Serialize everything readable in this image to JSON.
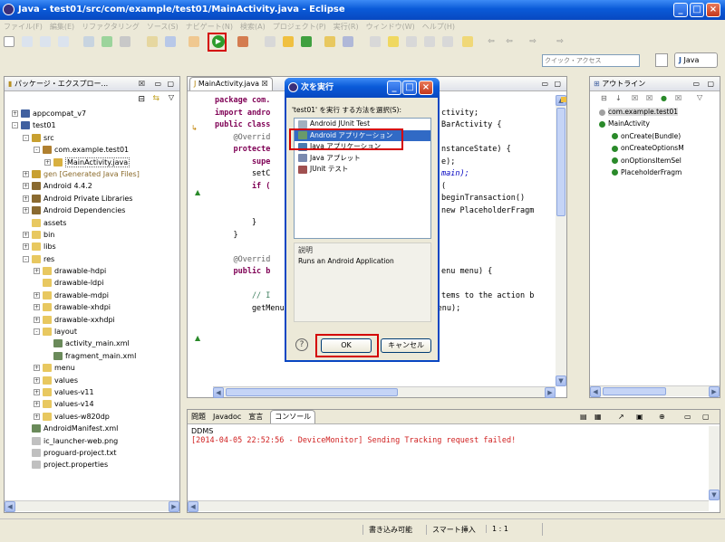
{
  "window": {
    "title": "Java - test01/src/com/example/test01/MainActivity.java - Eclipse"
  },
  "menu": [
    "ファイル(F)",
    "編集(E)",
    "リファクタリング",
    "ソース(S)",
    "ナビゲート(N)",
    "検索(A)",
    "プロジェクト(P)",
    "実行(R)",
    "ウィンドウ(W)",
    "ヘルプ(H)"
  ],
  "quick_access": {
    "placeholder": "クイック・アクセス"
  },
  "perspective": {
    "label": "Java"
  },
  "package_explorer": {
    "title": "パッケージ・エクスプロー...",
    "items": [
      {
        "label": "appcompat_v7",
        "indent": 0,
        "exp": "+",
        "icon": "project"
      },
      {
        "label": "test01",
        "indent": 0,
        "exp": "-",
        "icon": "project"
      },
      {
        "label": "src",
        "indent": 1,
        "exp": "-",
        "icon": "srcfolder"
      },
      {
        "label": "com.example.test01",
        "indent": 2,
        "exp": "-",
        "icon": "package"
      },
      {
        "label": "MainActivity.java",
        "indent": 3,
        "exp": "+",
        "icon": "java",
        "selected": true
      },
      {
        "label": "gen [Generated Java Files]",
        "indent": 1,
        "exp": "+",
        "icon": "srcfolder",
        "gray": true
      },
      {
        "label": "Android 4.4.2",
        "indent": 1,
        "exp": "+",
        "icon": "lib"
      },
      {
        "label": "Android Private Libraries",
        "indent": 1,
        "exp": "+",
        "icon": "lib"
      },
      {
        "label": "Android Dependencies",
        "indent": 1,
        "exp": "+",
        "icon": "lib"
      },
      {
        "label": "assets",
        "indent": 1,
        "exp": "",
        "icon": "folder"
      },
      {
        "label": "bin",
        "indent": 1,
        "exp": "+",
        "icon": "folder"
      },
      {
        "label": "libs",
        "indent": 1,
        "exp": "+",
        "icon": "folder"
      },
      {
        "label": "res",
        "indent": 1,
        "exp": "-",
        "icon": "folder"
      },
      {
        "label": "drawable-hdpi",
        "indent": 2,
        "exp": "+",
        "icon": "folder"
      },
      {
        "label": "drawable-ldpi",
        "indent": 2,
        "exp": "",
        "icon": "folder"
      },
      {
        "label": "drawable-mdpi",
        "indent": 2,
        "exp": "+",
        "icon": "folder"
      },
      {
        "label": "drawable-xhdpi",
        "indent": 2,
        "exp": "+",
        "icon": "folder"
      },
      {
        "label": "drawable-xxhdpi",
        "indent": 2,
        "exp": "+",
        "icon": "folder"
      },
      {
        "label": "layout",
        "indent": 2,
        "exp": "-",
        "icon": "folder"
      },
      {
        "label": "activity_main.xml",
        "indent": 3,
        "exp": "",
        "icon": "xml"
      },
      {
        "label": "fragment_main.xml",
        "indent": 3,
        "exp": "",
        "icon": "xml"
      },
      {
        "label": "menu",
        "indent": 2,
        "exp": "+",
        "icon": "folder"
      },
      {
        "label": "values",
        "indent": 2,
        "exp": "+",
        "icon": "folder"
      },
      {
        "label": "values-v11",
        "indent": 2,
        "exp": "+",
        "icon": "folder"
      },
      {
        "label": "values-v14",
        "indent": 2,
        "exp": "+",
        "icon": "folder"
      },
      {
        "label": "values-w820dp",
        "indent": 2,
        "exp": "+",
        "icon": "folder"
      },
      {
        "label": "AndroidManifest.xml",
        "indent": 1,
        "exp": "",
        "icon": "xml"
      },
      {
        "label": "ic_launcher-web.png",
        "indent": 1,
        "exp": "",
        "icon": "file"
      },
      {
        "label": "proguard-project.txt",
        "indent": 1,
        "exp": "",
        "icon": "file"
      },
      {
        "label": "project.properties",
        "indent": 1,
        "exp": "",
        "icon": "file"
      }
    ]
  },
  "editor": {
    "tab": "MainActivity.java",
    "lines": [
      {
        "t": "package com.",
        "k": true
      },
      {
        "t": "import andro",
        "k": true,
        "right": "ctivity;"
      },
      {
        "t": "public class",
        "k": true,
        "right": "BarActivity {"
      },
      {
        "t": "    @Overrid",
        "right": ""
      },
      {
        "t": "    protecte",
        "k": true,
        "right": "nstanceState) {"
      },
      {
        "t": "        supe",
        "k": true,
        "right": "e);"
      },
      {
        "t": "        setC",
        "right": "main);"
      },
      {
        "t": "        if (",
        "k": true,
        "right": "("
      },
      {
        "t": "",
        "right": "beginTransaction()"
      },
      {
        "t": "",
        "right": "new PlaceholderFragm"
      },
      {
        "t": "        }",
        "right": ""
      },
      {
        "t": "    }",
        "right": ""
      },
      {
        "t": "",
        "right": ""
      },
      {
        "t": "    @Overrid",
        "right": ""
      },
      {
        "t": "    public b",
        "k": true,
        "right": "enu menu) {"
      },
      {
        "t": "",
        "right": ""
      },
      {
        "t": "        // I",
        "right": "tems to the action b"
      },
      {
        "t": "        getMenuInflater().inflate(R.menu.main, menu);",
        "right": ""
      }
    ]
  },
  "outline": {
    "title": "アウトライン",
    "items": [
      {
        "label": "com.example.test01",
        "indent": 0
      },
      {
        "label": "MainActivity",
        "indent": 0
      },
      {
        "label": "onCreate(Bundle)",
        "indent": 1
      },
      {
        "label": "onCreateOptionsM",
        "indent": 1
      },
      {
        "label": "onOptionsItemSel",
        "indent": 1
      },
      {
        "label": "PlaceholderFragm",
        "indent": 1
      }
    ]
  },
  "console": {
    "tabs": [
      "問題",
      "Javadoc",
      "宣言",
      "コンソール"
    ],
    "header": "DDMS",
    "output": "[2014-04-05 22:52:56 - DeviceMonitor] Sending Tracking request failed!"
  },
  "dialog": {
    "title": "次を実行",
    "prompt": "'test01' を実行 する方法を選択(S):",
    "options": [
      "Android JUnit Test",
      "Android アプリケーション",
      "Java アプリケーション",
      "Java アプレット",
      "JUnit テスト"
    ],
    "selected_index": 1,
    "desc_label": "説明",
    "description": "Runs an Android Application",
    "ok": "OK",
    "cancel": "キャンセル"
  },
  "status": {
    "writable": "書き込み可能",
    "insert": "スマート挿入",
    "position": "1 : 1"
  },
  "colors": {
    "accent": "#316ac5",
    "highlight": "#d40000"
  }
}
